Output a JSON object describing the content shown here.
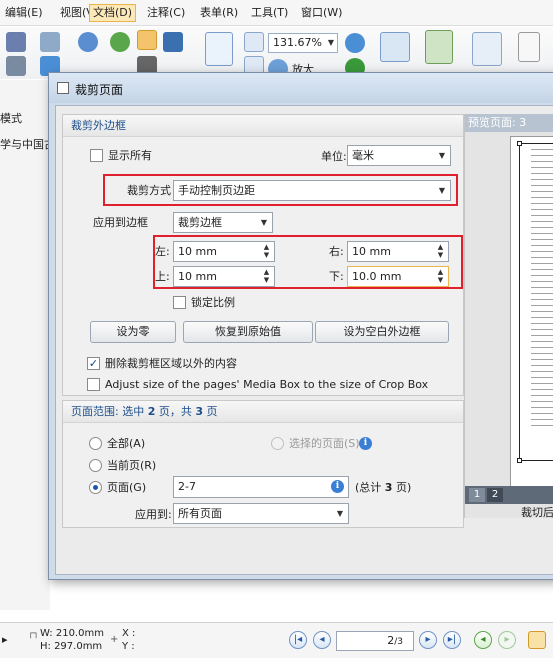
{
  "menubar": {
    "items": [
      "编辑(E)",
      "视图(V)",
      "文档(D)",
      "注释(C)",
      "表单(R)",
      "工具(T)",
      "窗口(W)"
    ],
    "active_index": 2
  },
  "toolbar": {
    "zoom": "131.67%",
    "enlarge_label": "放大"
  },
  "left_panel": {
    "mode_label": "模式",
    "doc_tab": "学与中国古"
  },
  "dialog": {
    "title": "裁剪页面",
    "crop_group": {
      "title": "裁剪外边框",
      "show_all": "显示所有",
      "unit_label": "单位:",
      "unit_value": "毫米",
      "crop_mode_label": "裁剪方式",
      "crop_mode_value": "手动控制页边距",
      "apply_to_box_label": "应用到边框",
      "apply_to_box_value": "裁剪边框",
      "left_label": "左:",
      "left_value": "10 mm",
      "right_label": "右:",
      "right_value": "10 mm",
      "top_label": "上:",
      "top_value": "10 mm",
      "bottom_label": "下:",
      "bottom_value": "10.0 mm",
      "lock_ratio": "锁定比例",
      "btn_zero": "设为零",
      "btn_restore": "恢复到原始值",
      "btn_blank": "设为空白外边框",
      "delete_outside": "删除裁剪框区域以外的内容",
      "adjust_media": "Adjust size of the pages' Media Box to the size of Crop Box"
    },
    "page_range": {
      "title_prefix": "页面范围: 选中",
      "selected_count": "2",
      "title_mid": "页，共",
      "total_count": "3",
      "title_suffix": "页",
      "all": "全部(A)",
      "selected_pages": "选择的页面(S)",
      "current": "当前页(R)",
      "pages": "页面(G)",
      "pages_value": "2-7",
      "total_prefix": "(总计",
      "total_pages": "3",
      "total_suffix": "页)",
      "apply_to_label": "应用到:",
      "apply_to_value": "所有页面"
    },
    "preview": {
      "title": "预览页面: 3",
      "tabs": [
        "1",
        "2"
      ],
      "selected_tab": 1,
      "footer": "裁切后"
    }
  },
  "statusbar": {
    "width": "W: 210.0mm",
    "height": "H: 297.0mm",
    "x_label": "X :",
    "y_label": "Y :",
    "page": "2",
    "page_total": "/3"
  }
}
